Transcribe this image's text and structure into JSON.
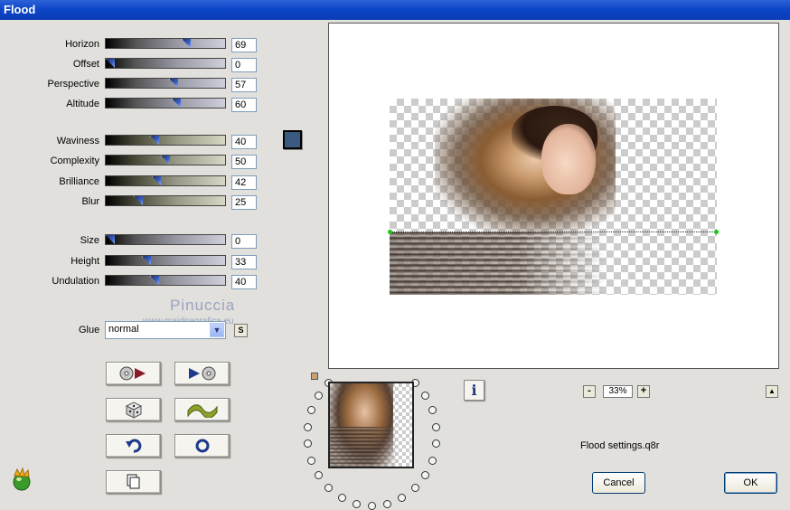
{
  "window": {
    "title": "Flood"
  },
  "sliders": [
    {
      "id": "horizon",
      "label": "Horizon",
      "value": "69",
      "fraction": 0.69,
      "track": "gray"
    },
    {
      "id": "offset",
      "label": "Offset",
      "value": "0",
      "fraction": 0.0,
      "track": "gray"
    },
    {
      "id": "perspective",
      "label": "Perspective",
      "value": "57",
      "fraction": 0.57,
      "track": "gray"
    },
    {
      "id": "altitude",
      "label": "Altitude",
      "value": "60",
      "fraction": 0.6,
      "track": "gray"
    },
    {
      "id": "waviness",
      "label": "Waviness",
      "value": "40",
      "fraction": 0.4,
      "track": "tan"
    },
    {
      "id": "complexity",
      "label": "Complexity",
      "value": "50",
      "fraction": 0.5,
      "track": "tan"
    },
    {
      "id": "brilliance",
      "label": "Brilliance",
      "value": "42",
      "fraction": 0.42,
      "track": "tan"
    },
    {
      "id": "blur",
      "label": "Blur",
      "value": "25",
      "fraction": 0.25,
      "track": "tan"
    },
    {
      "id": "size",
      "label": "Size",
      "value": "0",
      "fraction": 0.0,
      "track": "gray"
    },
    {
      "id": "height",
      "label": "Height",
      "value": "33",
      "fraction": 0.33,
      "track": "gray"
    },
    {
      "id": "undulation",
      "label": "Undulation",
      "value": "40",
      "fraction": 0.4,
      "track": "gray"
    }
  ],
  "color": {
    "swatch": "#3b5a82"
  },
  "watermark": {
    "name": "Pinuccia",
    "url": "www.maidiregrafica.eu"
  },
  "glue": {
    "label": "Glue",
    "value": "normal",
    "s_label": "S"
  },
  "buttons": {
    "load_preset": "load-preset-icon",
    "save_preset": "save-preset-icon",
    "randomize": "dice-icon",
    "wave": "wave-icon",
    "undo": "undo-icon",
    "reset": "reset-icon",
    "copy": "copy-icon"
  },
  "zoom": {
    "minus": "-",
    "value": "33%",
    "plus": "+",
    "up": "▲"
  },
  "info": {
    "label": "i"
  },
  "settings_file": "Flood settings.q8r",
  "actions": {
    "cancel": "Cancel",
    "ok": "OK"
  }
}
